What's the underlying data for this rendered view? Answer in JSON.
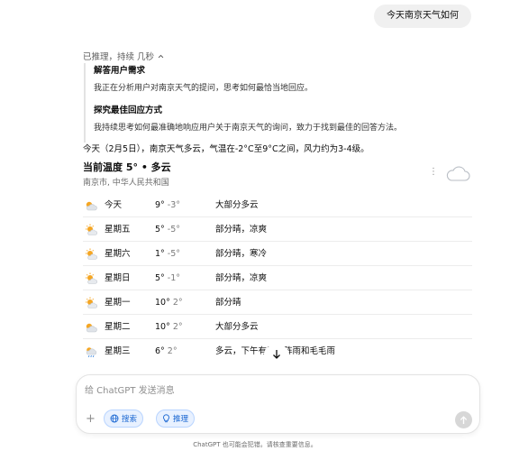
{
  "user_message": "今天南京天气如何",
  "reasoning": {
    "toggle_label": "已推理，持续 几秒",
    "steps": [
      {
        "title": "解答用户需求",
        "body": "我正在分析用户对南京天气的提问，思考如何最恰当地回应。"
      },
      {
        "title": "探究最佳回应方式",
        "body": "我持续思考如何最准确地响应用户关于南京天气的询问，致力于找到最佳的回答方法。"
      }
    ]
  },
  "answer": "今天（2月5日），南京天气多云，气温在-2°C至9°C之间，风力约为3-4级。",
  "weather": {
    "current": "当前温度 5° • 多云",
    "location": "南京市, 中华人民共和国",
    "forecast": [
      {
        "day": "今天",
        "hi": "9°",
        "lo": "-3°",
        "desc": "大部分多云",
        "icon": "mostly-cloudy-icon"
      },
      {
        "day": "星期五",
        "hi": "5°",
        "lo": "-5°",
        "desc": "部分晴，凉爽",
        "icon": "partly-sunny-icon"
      },
      {
        "day": "星期六",
        "hi": "1°",
        "lo": "-5°",
        "desc": "部分晴，寒冷",
        "icon": "partly-sunny-icon"
      },
      {
        "day": "星期日",
        "hi": "5°",
        "lo": "-1°",
        "desc": "部分晴，凉爽",
        "icon": "partly-sunny-icon"
      },
      {
        "day": "星期一",
        "hi": "10°",
        "lo": "2°",
        "desc": "部分晴",
        "icon": "partly-sunny-icon"
      },
      {
        "day": "星期二",
        "hi": "10°",
        "lo": "2°",
        "desc": "大部分多云",
        "icon": "mostly-cloudy-icon"
      },
      {
        "day": "星期三",
        "hi": "6°",
        "lo": "2°",
        "desc": "多云，下午有零星阵雨和毛毛雨",
        "icon": "rain-icon"
      }
    ]
  },
  "composer": {
    "placeholder": "给 ChatGPT 发送消息",
    "search_label": "搜索",
    "reason_label": "推理"
  },
  "disclaimer": "ChatGPT 也可能会犯错。请核查重要信息。",
  "colors": {
    "sun": "#f5a623",
    "cloud": "#cfd4da",
    "accent": "#1a67d2",
    "rain": "#4a90e2"
  }
}
